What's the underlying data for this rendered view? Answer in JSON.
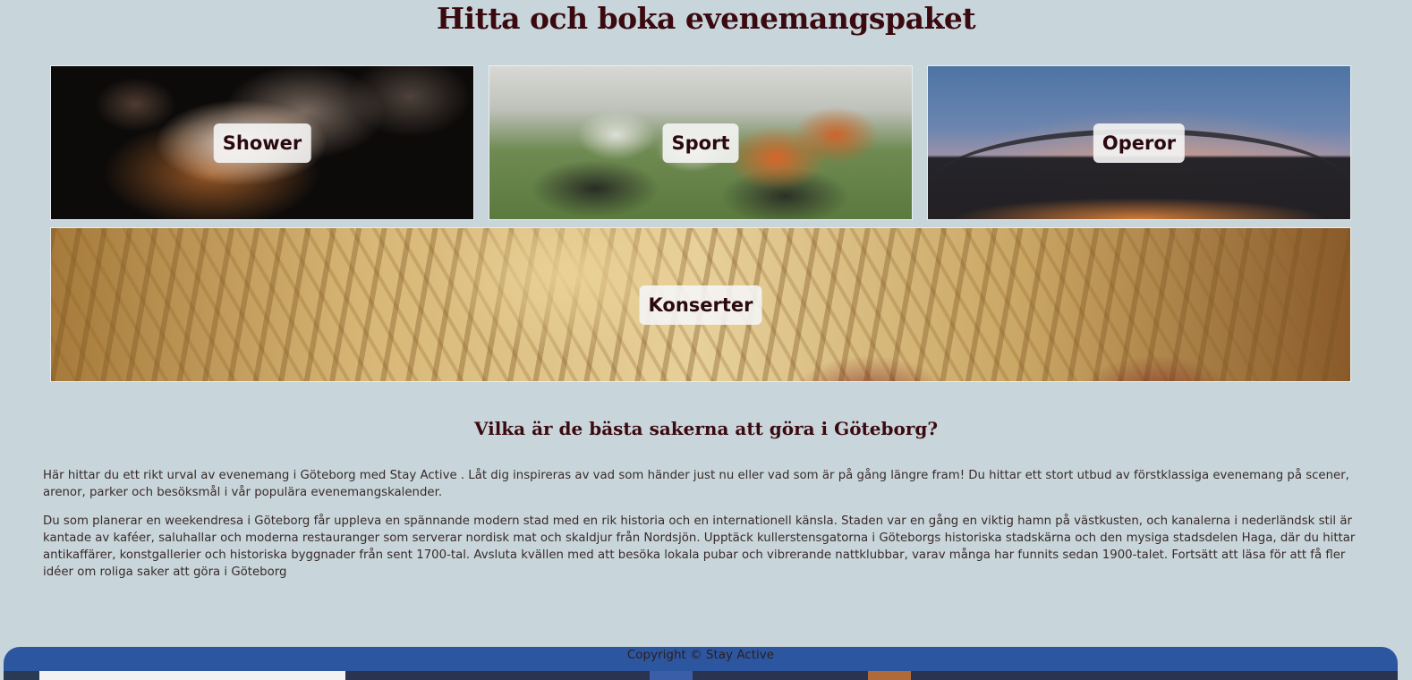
{
  "page": {
    "title": "Hitta och boka evenemangspaket"
  },
  "categories": [
    {
      "label": "Shower"
    },
    {
      "label": "Sport"
    },
    {
      "label": "Operor"
    },
    {
      "label": "Konserter"
    }
  ],
  "content": {
    "heading": "Vilka är de bästa sakerna att göra i Göteborg?",
    "paragraphs": [
      "Här hittar du ett rikt urval av evenemang i Göteborg med Stay Active . Låt dig inspireras av vad som händer just nu eller vad som är på gång längre fram! Du hittar ett stort utbud av förstklassiga evenemang på scener, arenor, parker och besöksmål i vår populära evenemangskalender.",
      "Du som planerar en weekendresa i Göteborg får uppleva en spännande modern stad med en rik historia och en internationell känsla. Staden var en gång en viktig hamn på västkusten, och kanalerna i nederländsk stil är kantade av kaféer, saluhallar och moderna restauranger som serverar nordisk mat och skaldjur från Nordsjön. Upptäck kullerstensgatorna i Göteborgs historiska stadskärna och den mysiga stadsdelen Haga, där du hittar antikaffärer, konstgallerier och historiska byggnader från sent 1700-tal. Avsluta kvällen med att besöka lokala pubar och vibrerande nattklubbar, varav många har funnits sedan 1900-talet. Fortsätt att läsa för att få fler idéer om roliga saker att göra i Göteborg"
    ]
  },
  "footer": {
    "copyright": "Copyright © Stay Active"
  },
  "colors": {
    "background": "#c8d6db",
    "heading": "#3b0a10",
    "footer": "#2d56a0"
  }
}
